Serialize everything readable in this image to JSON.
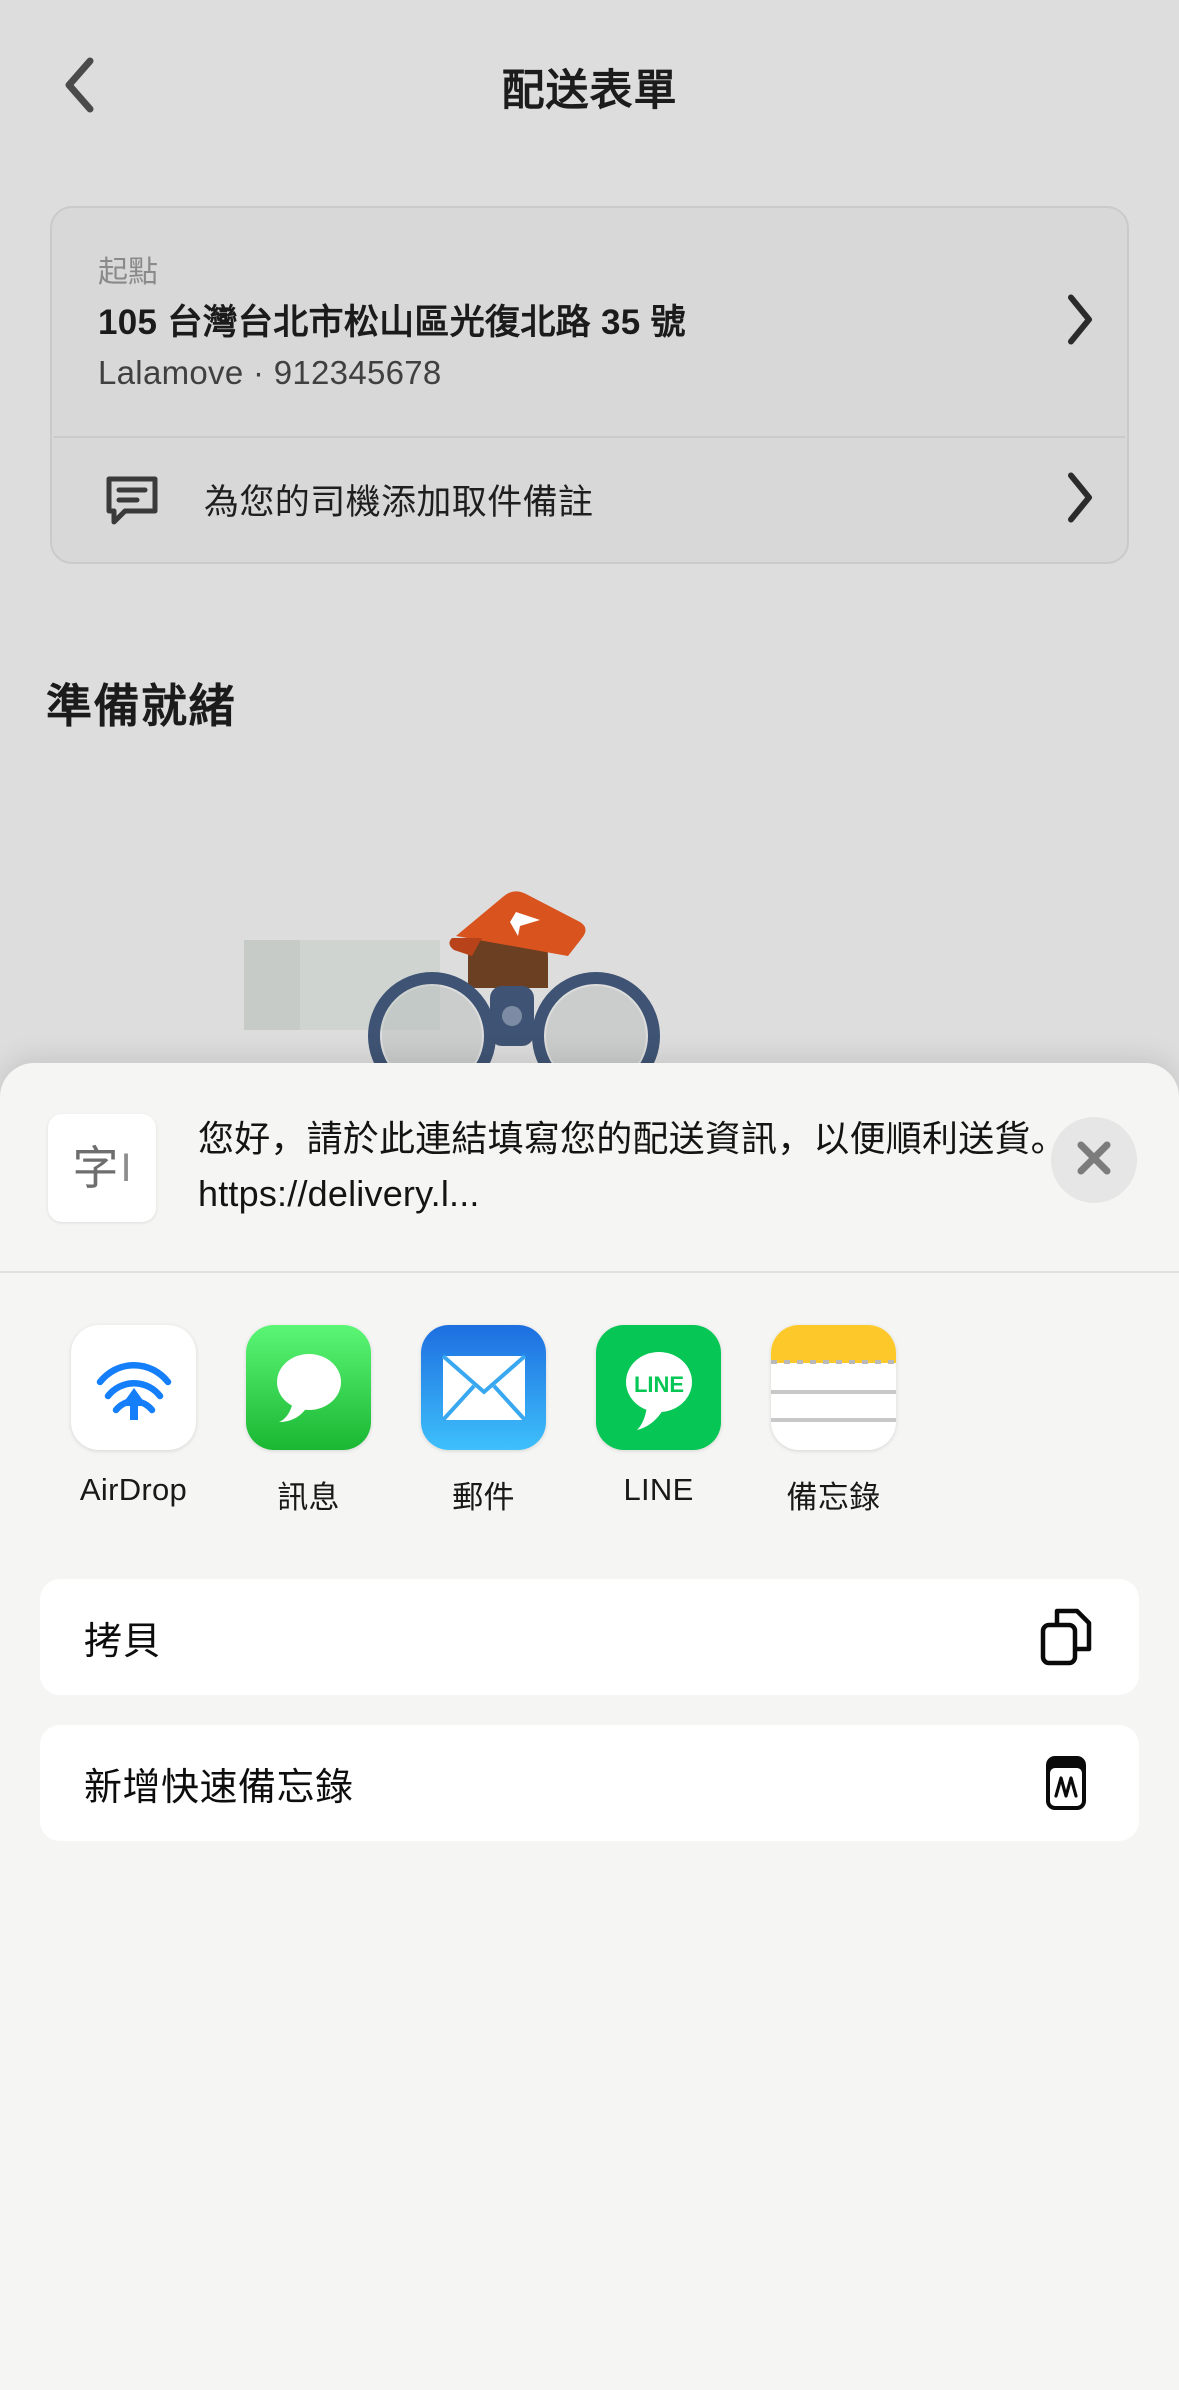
{
  "app": {
    "nav": {
      "back_icon": "chevron-left-icon",
      "title": "配送表單"
    },
    "address_card": {
      "label": "起點",
      "address": "105 台灣台北市松山區光復北路 35 號",
      "contact": "Lalamove · 912345678",
      "chevron_icon": "chevron-right-icon",
      "note_icon": "message-note-icon",
      "note_label": "為您的司機添加取件備註",
      "note_chevron_icon": "chevron-right-icon"
    },
    "section_title": "準備就緒"
  },
  "share_sheet": {
    "preview": {
      "thumb_glyph": "字",
      "thumb_cursor": "I",
      "thumb_icon": "text-document-icon",
      "text": "您好，請於此連結填寫您的配送資訊，以便順利送貨。 https://delivery.l...",
      "close_icon": "close-icon"
    },
    "apps": [
      {
        "label": "AirDrop",
        "icon": "airdrop-icon"
      },
      {
        "label": "訊息",
        "icon": "messages-icon"
      },
      {
        "label": "郵件",
        "icon": "mail-icon"
      },
      {
        "label": "LINE",
        "icon": "line-icon",
        "wordmark": "LINE"
      },
      {
        "label": "備忘錄",
        "icon": "notes-icon"
      }
    ],
    "actions": [
      {
        "label": "拷貝",
        "icon": "copy-icon"
      },
      {
        "label": "新增快速備忘錄",
        "icon": "quick-note-icon"
      }
    ]
  },
  "colors": {
    "app_background": "#dddddd",
    "sheet_background": "#f5f5f4",
    "card_background": "#d8d8d8",
    "line_green": "#06c755",
    "messages_green": "#1ab733",
    "mail_blue": "#1d6ee0",
    "airdrop_blue": "#147efb",
    "notes_yellow": "#fdc92a",
    "lalamove_orange": "#d9531e"
  }
}
